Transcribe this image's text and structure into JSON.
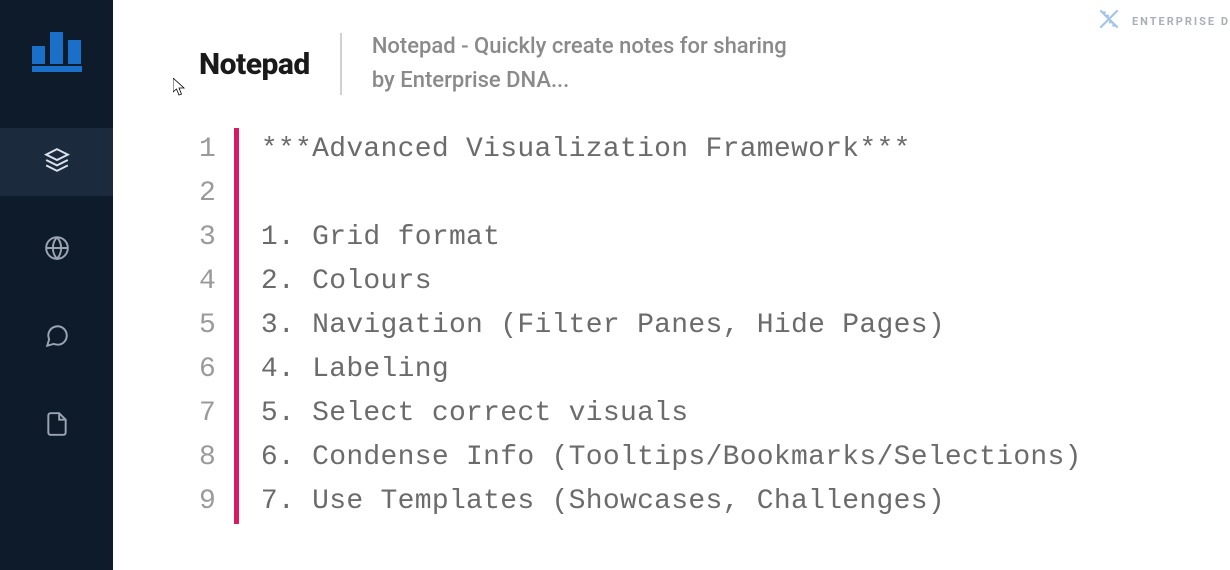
{
  "header": {
    "title": "Notepad",
    "subtitle_line1": "Notepad - Quickly create notes for sharing",
    "subtitle_line2": "by Enterprise DNA..."
  },
  "watermark": {
    "text": "ENTERPRISE D"
  },
  "editor": {
    "gutter_color": "#d81b60",
    "lines": [
      {
        "num": "1",
        "text": "***Advanced Visualization Framework***"
      },
      {
        "num": "2",
        "text": ""
      },
      {
        "num": "3",
        "text": "1. Grid format"
      },
      {
        "num": "4",
        "text": "2. Colours"
      },
      {
        "num": "5",
        "text": "3. Navigation (Filter Panes, Hide Pages)"
      },
      {
        "num": "6",
        "text": "4. Labeling"
      },
      {
        "num": "7",
        "text": "5. Select correct visuals"
      },
      {
        "num": "8",
        "text": "6. Condense Info (Tooltips/Bookmarks/Selections)"
      },
      {
        "num": "9",
        "text": "7. Use Templates (Showcases, Challenges)"
      }
    ]
  },
  "sidebar": {
    "icons": [
      "layers-icon",
      "globe-icon",
      "chat-icon",
      "document-icon"
    ],
    "active_index": 0
  }
}
